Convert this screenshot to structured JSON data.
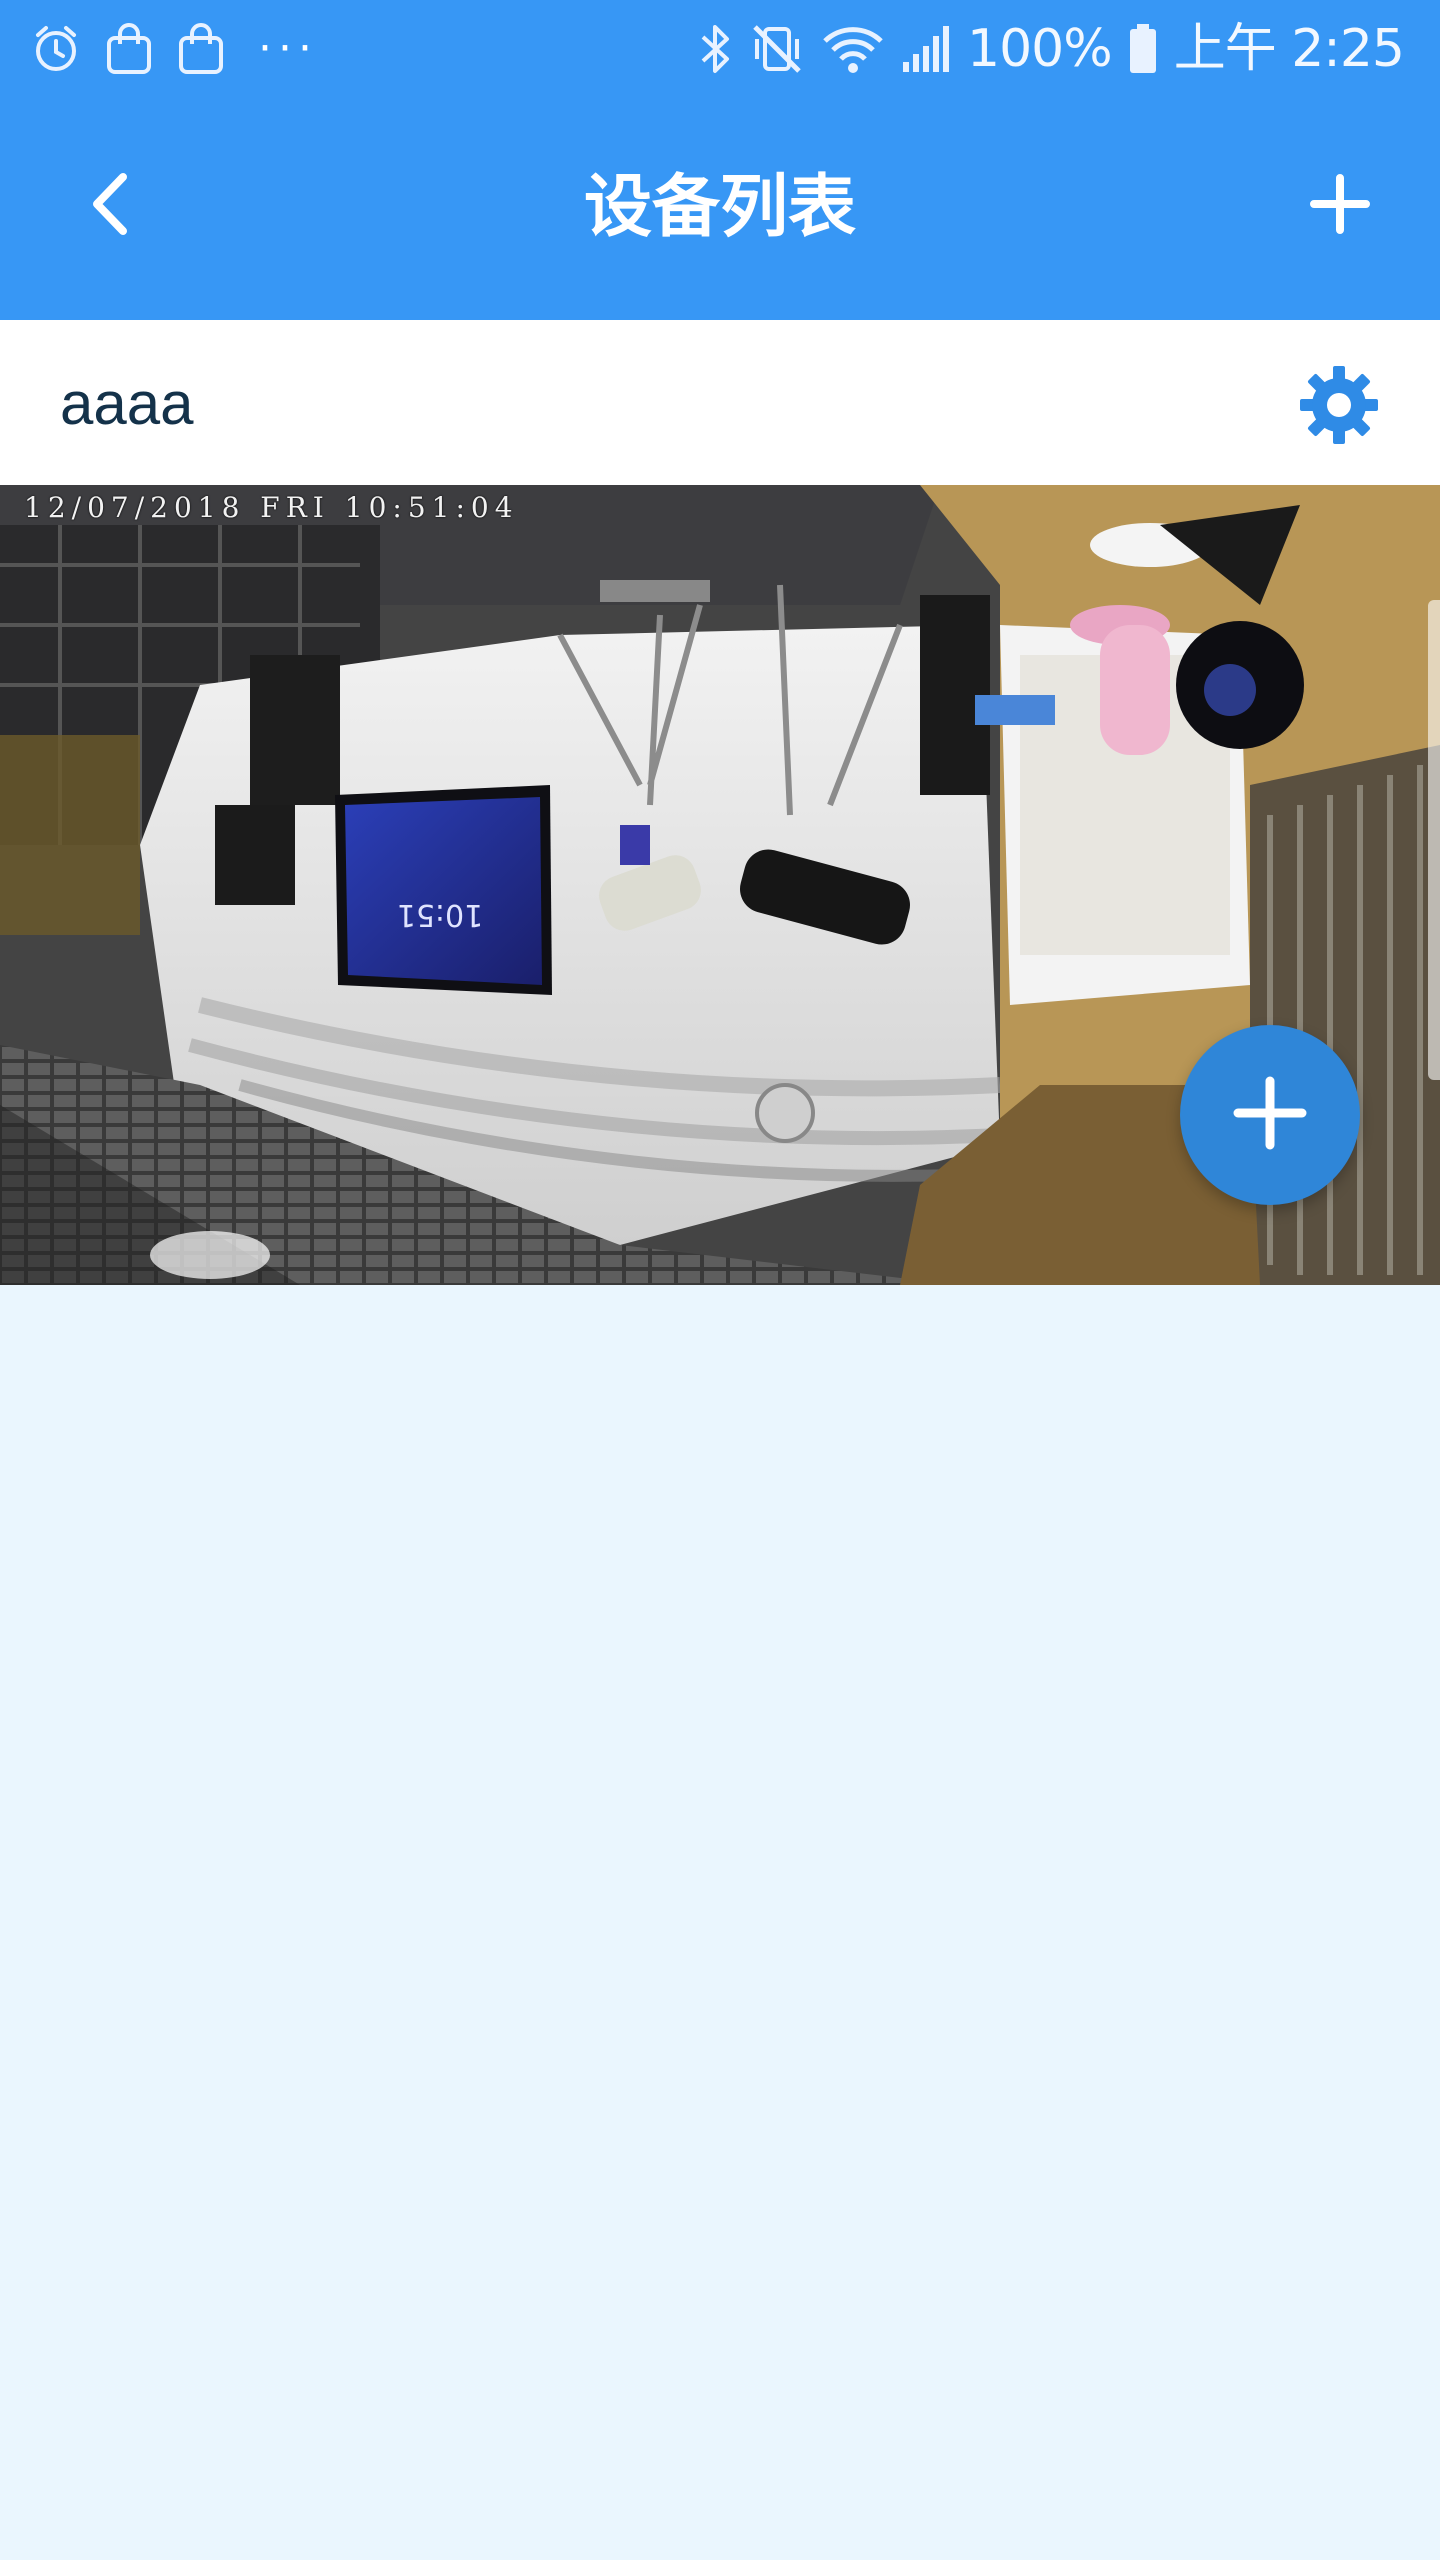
{
  "status_bar": {
    "battery": "100%",
    "time": "上午 2:25",
    "dots": "···",
    "icons": [
      "alarm-icon",
      "shopping-bag-icon",
      "shopping-bag-icon",
      "more-dots-icon",
      "bluetooth-icon",
      "vibrate-mute-icon",
      "wifi-icon",
      "signal-icon",
      "battery-icon"
    ]
  },
  "header": {
    "title": "设备列表",
    "back_icon": "chevron-left-icon",
    "add_icon": "plus-icon"
  },
  "device": {
    "name": "aaaa",
    "settings_icon": "gear-icon",
    "preview": {
      "timestamp": "12/07/2018 FRI 10:51:04",
      "tv_clock": "10:51"
    }
  },
  "fab": {
    "icon": "plus-icon"
  },
  "colors": {
    "primary": "#3797f5",
    "background": "#eaf6fe",
    "fab": "#2f86d8",
    "device_name": "#14324a"
  }
}
